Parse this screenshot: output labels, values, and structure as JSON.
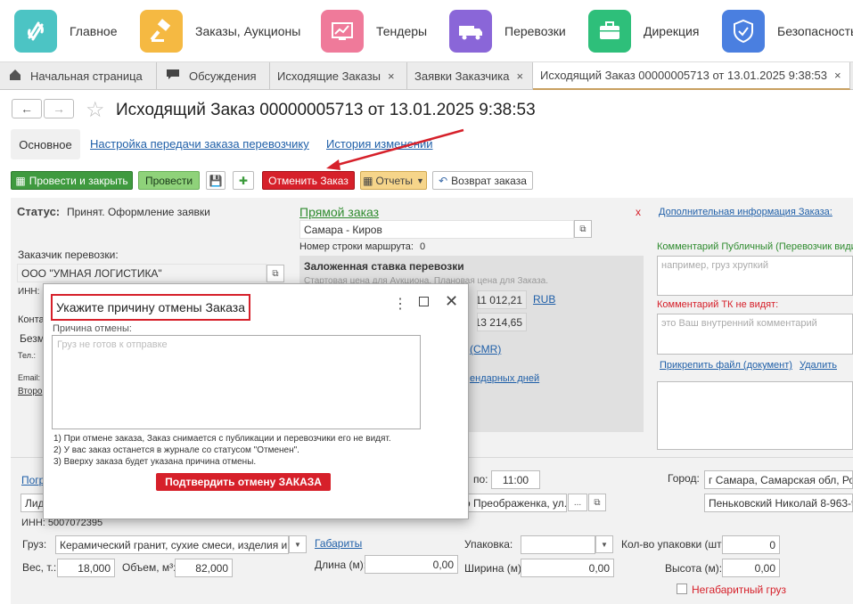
{
  "sections": [
    {
      "label": "Главное",
      "icon": "main-section-icon",
      "color": "#4cc4c4"
    },
    {
      "label": "Заказы, Аукционы",
      "icon": "auction-gavel-icon",
      "color": "#f5b942"
    },
    {
      "label": "Тендеры",
      "icon": "tender-chart-icon",
      "color": "#ef7a9a"
    },
    {
      "label": "Перевозки",
      "icon": "truck-icon",
      "color": "#8a66d8"
    },
    {
      "label": "Дирекция",
      "icon": "briefcase-icon",
      "color": "#2ebf7a"
    },
    {
      "label": "Безопасность",
      "icon": "shield-icon",
      "color": "#4a7fe0"
    }
  ],
  "tabs": [
    {
      "label": "Начальная страница",
      "icon": "home-icon"
    },
    {
      "label": "Обсуждения",
      "icon": "chat-icon"
    },
    {
      "label": "Исходящие Заказы",
      "close": "×"
    },
    {
      "label": "Заявки Заказчика",
      "close": "×"
    },
    {
      "label": "Исходящий Заказ 00000005713 от 13.01.2025 9:38:53",
      "close": "×"
    }
  ],
  "page_title": "Исходящий Заказ 00000005713 от 13.01.2025 9:38:53",
  "subtabs": {
    "main": "Основное",
    "settings": "Настройка передачи заказа перевозчику",
    "history": "История изменений"
  },
  "toolbar": {
    "post_close": "Провести и закрыть",
    "post": "Провести",
    "cancel_order": "Отменить Заказ",
    "reports": "Отчеты",
    "return_order": "Возврат заказа"
  },
  "form": {
    "status_label": "Статус:",
    "status_value": "Принят. Оформление заявки",
    "customer_label": "Заказчик перевозки:",
    "customer_value": "ООО \"УМНАЯ ЛОГИСТИКА\"",
    "inn_label": "ИНН:",
    "contact_label": "Конта",
    "contact_value": "Безм",
    "tel_label": "Тел.:",
    "email_label": "Email:",
    "second_link": "Второ",
    "direct_order": "Прямой заказ",
    "route": "Самара - Киров",
    "route_row_label": "Номер строки маршрута:",
    "route_row_value": "0",
    "rate_header": "Заложенная ставка перевозки",
    "rate_sub": "Стартовая цена для Аукциона. Плановая цена для Заказа.",
    "rate1": "11 012,21",
    "currency": "RUB",
    "rate2": "13 214,65",
    "cmr_link": "(CMR)",
    "days_link": "ендарных дней",
    "extra_info_link": "Дополнительная информация Заказа:",
    "close_x": "x",
    "public_comment_label": "Комментарий Публичный (Перевозчик види",
    "public_comment_placeholder": "например, груз хрупкий",
    "tk_comment_label": "Комментарий ТК не видят:",
    "tk_comment_placeholder": "это Ваш внутренний комментарий",
    "attach_link": "Прикрепить файл (документ)",
    "delete_link": "Удалить",
    "load_link": "Погр",
    "load_field": "Лид",
    "time_label": "по:",
    "time_value": "11:00",
    "city_label": "Город:",
    "city_value": "г Самара, Самарская обл, Росси",
    "address_value": "о Преображенка, ул. I",
    "ellipsis": "...",
    "contact_person": "Пеньковский Николай 8-963-910",
    "inn_value": "ИНН: 5007072395",
    "cargo_label": "Груз:",
    "cargo_value": "Керамический гранит, сухие смеси, изделия и пр",
    "dims_link": "Габариты",
    "packing_label": "Упаковка:",
    "packing_count_label": "Кол-во упаковки (шт):",
    "packing_count_value": "0",
    "weight_label": "Вес, т.:",
    "weight_value": "18,000",
    "volume_label": "Объем, м³:",
    "volume_value": "82,000",
    "length_label": "Длина (м):",
    "length_value": "0,00",
    "width_label": "Ширина (м):",
    "width_value": "0,00",
    "height_label": "Высота (м):",
    "height_value": "0,00",
    "oversize_label": "Негабаритный груз"
  },
  "modal": {
    "title": "Укажите причину отмены Заказа",
    "reason_label": "Причина отмены:",
    "reason_placeholder": "Груз не готов к отправке",
    "note1": "1) При отмене заказа, Заказ снимается с публикации и перевозчики его не видят.",
    "note2": "2) У вас заказ останется в журнале со статусом \"Отменен\".",
    "note3": "3) Вверху заказа будет указана причина отмены.",
    "confirm": "Подтвердить отмену ЗАКАЗА"
  },
  "colors": {
    "accent_red": "#d6202a",
    "link_blue": "#1f5fa8",
    "green_label": "#2e8b2e"
  }
}
